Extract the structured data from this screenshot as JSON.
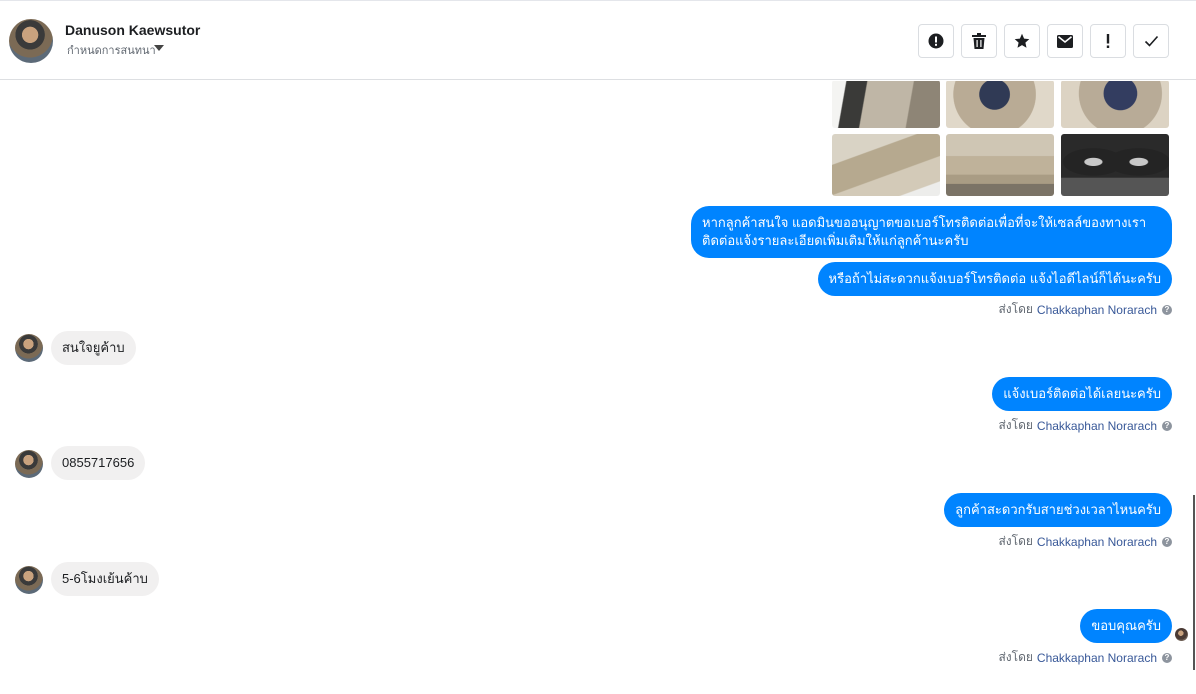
{
  "header": {
    "contact_name": "Danuson Kaewsutor",
    "subtitle": "กำหนดการสนทนา",
    "actions": [
      {
        "name": "spam-button",
        "icon": "alert-circle-icon"
      },
      {
        "name": "delete-button",
        "icon": "trash-icon"
      },
      {
        "name": "star-button",
        "icon": "star-icon"
      },
      {
        "name": "mark-unread-button",
        "icon": "envelope-icon"
      },
      {
        "name": "follow-up-button",
        "icon": "exclamation-icon"
      },
      {
        "name": "mark-done-button",
        "icon": "check-icon"
      }
    ]
  },
  "colors": {
    "outgoing_bubble": "#0084ff",
    "incoming_bubble": "#f1f0f0",
    "sender_link": "#385898"
  },
  "photos": [
    {
      "name": "photo-door-interior"
    },
    {
      "name": "photo-steering-wheel-1"
    },
    {
      "name": "photo-steering-wheel-2"
    },
    {
      "name": "photo-dashboard-side"
    },
    {
      "name": "photo-rear-seats"
    },
    {
      "name": "photo-instrument-cluster"
    }
  ],
  "messages": [
    {
      "direction": "out",
      "text_line1": "หากลูกค้าสนใจ แอดมินขออนุญาตขอเบอร์โทรติดต่อเพื่อที่จะให้เซลล์ของทางเรา",
      "text_line2": "ติดต่อแจ้งรายละเอียดเพิ่มเติมให้แก่ลูกค้านะครับ"
    },
    {
      "direction": "out",
      "text": "หรือถ้าไม่สะดวกแจ้งเบอร์โทรติดต่อ แจ้งไอดีไลน์ก็ได้นะครับ"
    },
    {
      "direction": "in",
      "text": "สนใจยูค้าบ"
    },
    {
      "direction": "out",
      "text": "แจ้งเบอร์ติดต่อได้เลยนะครับ"
    },
    {
      "direction": "in",
      "text": "0855717656"
    },
    {
      "direction": "out",
      "text": "ลูกค้าสะดวกรับสายช่วงเวลาไหนครับ"
    },
    {
      "direction": "in",
      "text": "5-6โมงเย้นค้าบ"
    },
    {
      "direction": "out",
      "text": "ขอบคุณครับ"
    }
  ],
  "sent_by": {
    "prefix": "ส่งโดย",
    "sender": "Chakkaphan Norarach",
    "help_glyph": "?"
  }
}
